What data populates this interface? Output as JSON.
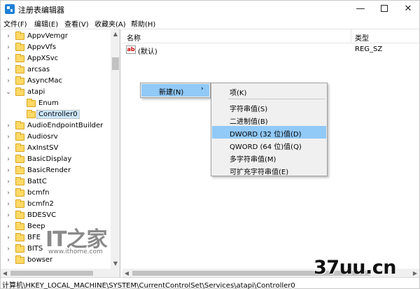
{
  "window": {
    "title": "注册表编辑器",
    "controls": {
      "minimize": "—",
      "close": "✕"
    }
  },
  "menubar": [
    "文件(F)",
    "编辑(E)",
    "查看(V)",
    "收藏夹(A)",
    "帮助(H)"
  ],
  "tree": {
    "items": [
      {
        "label": "AppvVemgr",
        "expander": "›",
        "level": 1
      },
      {
        "label": "AppvVfs",
        "expander": "›",
        "level": 1
      },
      {
        "label": "AppXSvc",
        "expander": "›",
        "level": 1
      },
      {
        "label": "arcsas",
        "expander": "›",
        "level": 1
      },
      {
        "label": "AsyncMac",
        "expander": "›",
        "level": 1
      },
      {
        "label": "atapi",
        "expander": "⌄",
        "level": 1
      },
      {
        "label": "Enum",
        "expander": "",
        "level": 2
      },
      {
        "label": "Controller0",
        "expander": "",
        "level": 2,
        "selected": true
      },
      {
        "label": "AudioEndpointBuilder",
        "expander": "›",
        "level": 1
      },
      {
        "label": "Audiosrv",
        "expander": "›",
        "level": 1
      },
      {
        "label": "AxInstSV",
        "expander": "›",
        "level": 1
      },
      {
        "label": "BasicDisplay",
        "expander": "›",
        "level": 1
      },
      {
        "label": "BasicRender",
        "expander": "›",
        "level": 1
      },
      {
        "label": "BattC",
        "expander": "›",
        "level": 1
      },
      {
        "label": "bcmfn",
        "expander": "›",
        "level": 1
      },
      {
        "label": "bcmfn2",
        "expander": "›",
        "level": 1
      },
      {
        "label": "BDESVC",
        "expander": "›",
        "level": 1
      },
      {
        "label": "Beep",
        "expander": "›",
        "level": 1
      },
      {
        "label": "BFE",
        "expander": "›",
        "level": 1
      },
      {
        "label": "BITS",
        "expander": "›",
        "level": 1
      },
      {
        "label": "bowser",
        "expander": "›",
        "level": 1
      }
    ]
  },
  "list": {
    "columns": {
      "name": "名称",
      "type": "类型"
    },
    "rows": [
      {
        "icon": "ab",
        "name": "(默认)",
        "type": "REG_SZ"
      }
    ]
  },
  "context_menu": {
    "new_label": "新建(N)",
    "arrow": "›",
    "submenu": [
      "项(K)",
      "字符串值(S)",
      "二进制值(B)",
      "DWORD (32 位)值(D)",
      "QWORD (64 位)值(Q)",
      "多字符串值(M)",
      "可扩充字符串值(E)"
    ]
  },
  "statusbar": {
    "path": "计算机\\HKEY_LOCAL_MACHINE\\SYSTEM\\CurrentControlSet\\Services\\atapi\\Controller0"
  },
  "watermarks": {
    "ithome_logo": "IT之家",
    "ithome_url": "www.ithome.com",
    "site": "37uu.cn"
  },
  "colors": {
    "menu_highlight": "#91c9f7",
    "menu_background": "#f0f0f0",
    "folder": "#ffd966",
    "selection": "#cce8ff"
  }
}
